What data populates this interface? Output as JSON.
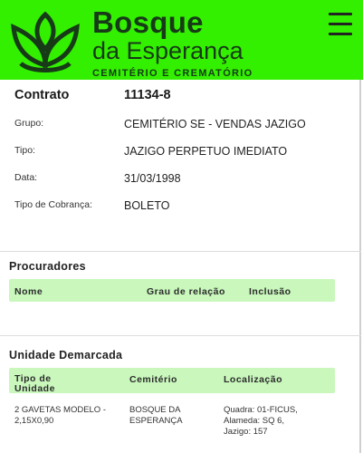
{
  "header": {
    "brand_name": "Bosque",
    "brand_sub": "da Esperança",
    "brand_tagline": "CEMITÉRIO E CREMATÓRIO",
    "accent_color": "#33f000",
    "menu_icon": "hamburger-menu-icon"
  },
  "contract": {
    "label": "Contrato",
    "number": "11134-8",
    "fields": [
      {
        "label": "Grupo:",
        "value": "CEMITÉRIO SE - VENDAS JAZIGO"
      },
      {
        "label": "Tipo:",
        "value": "JAZIGO PERPETUO IMEDIATO"
      },
      {
        "label": "Data:",
        "value": "31/03/1998"
      },
      {
        "label": "Tipo de Cobrança:",
        "value": "BOLETO"
      }
    ]
  },
  "procuradores": {
    "title": "Procuradores",
    "columns": [
      "Nome",
      "Grau de relação",
      "Inclusão"
    ],
    "rows": []
  },
  "unidade": {
    "title": "Unidade Demarcada",
    "columns": [
      "Tipo de Unidade",
      "Cemitério",
      "Localização"
    ],
    "rows": [
      {
        "tipo": "2 GAVETAS MODELO - 2,15X0,90",
        "cemiterio": "BOSQUE DA ESPERANÇA",
        "localizacao": "Quadra: 01-FICUS, Alameda: SQ 6, Jazigo: 157"
      }
    ]
  }
}
